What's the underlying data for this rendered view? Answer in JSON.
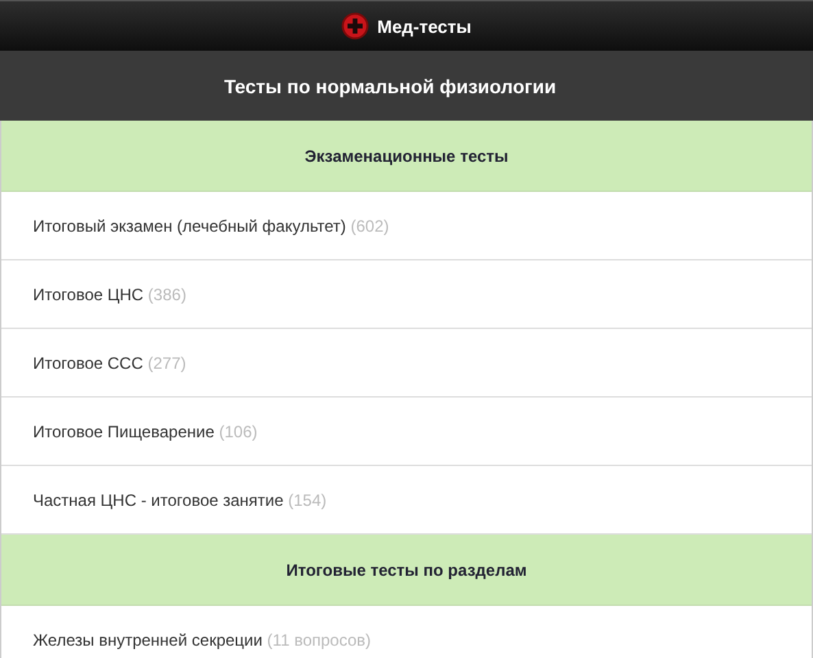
{
  "app_bar": {
    "title": "Мед-тесты"
  },
  "page_title": "Тесты по нормальной физиологии",
  "list": [
    {
      "kind": "header",
      "label": "Экзаменационные тесты"
    },
    {
      "kind": "test",
      "label": "Итоговый экзамен (лечебный факультет)",
      "count": "(602)"
    },
    {
      "kind": "test",
      "label": "Итоговое ЦНС",
      "count": "(386)"
    },
    {
      "kind": "test",
      "label": "Итоговое ССС",
      "count": "(277)"
    },
    {
      "kind": "test",
      "label": "Итоговое Пищеварение",
      "count": "(106)"
    },
    {
      "kind": "test",
      "label": "Частная ЦНС - итоговое занятие",
      "count": "(154)"
    },
    {
      "kind": "header",
      "label": "Итоговые тесты по разделам"
    },
    {
      "kind": "test",
      "label": "Железы внутренней секреции",
      "count": "(11 вопросов)"
    }
  ]
}
